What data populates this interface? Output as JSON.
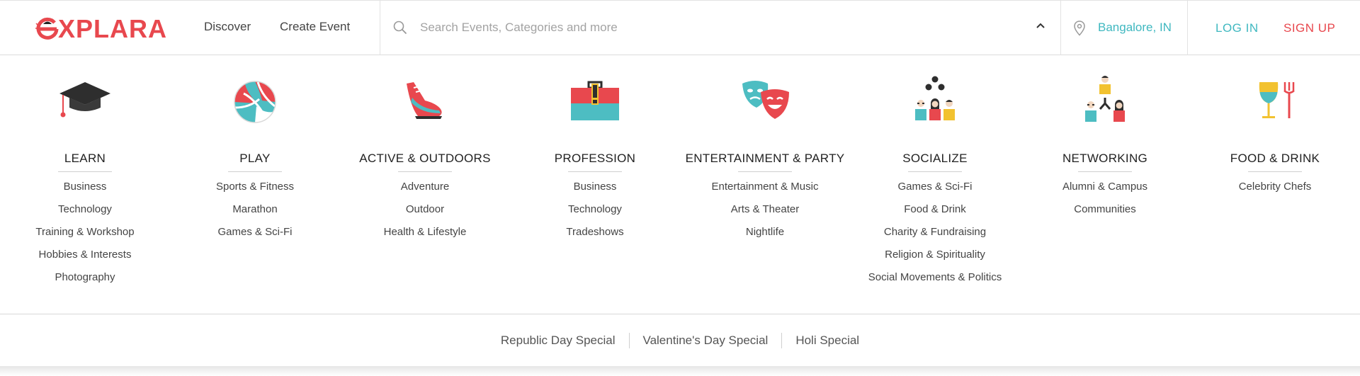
{
  "brand": {
    "logo_text": "XPLARA",
    "brand_color": "#e8484e",
    "accent_color": "#3fb8c0"
  },
  "nav": {
    "discover": "Discover",
    "create_event": "Create Event"
  },
  "search": {
    "placeholder": "Search Events, Categories and more",
    "value": ""
  },
  "location": {
    "text": "Bangalore, IN"
  },
  "auth": {
    "login": "LOG IN",
    "signup": "SIGN UP"
  },
  "categories": [
    {
      "title": "LEARN",
      "icon": "graduation-cap-icon",
      "items": [
        "Business",
        "Technology",
        "Training & Workshop",
        "Hobbies & Interests",
        "Photography"
      ]
    },
    {
      "title": "PLAY",
      "icon": "volleyball-icon",
      "items": [
        "Sports & Fitness",
        "Marathon",
        "Games & Sci-Fi"
      ]
    },
    {
      "title": "ACTIVE & OUTDOORS",
      "icon": "running-shoe-icon",
      "items": [
        "Adventure",
        "Outdoor",
        "Health & Lifestyle"
      ]
    },
    {
      "title": "PROFESSION",
      "icon": "briefcase-icon",
      "items": [
        "Business",
        "Technology",
        "Tradeshows"
      ]
    },
    {
      "title": "ENTERTAINMENT & PARTY",
      "icon": "theater-masks-icon",
      "items": [
        "Entertainment & Music",
        "Arts & Theater",
        "Nightlife"
      ]
    },
    {
      "title": "SOCIALIZE",
      "icon": "people-group-icon",
      "items": [
        "Games & Sci-Fi",
        "Food & Drink",
        "Charity & Fundraising",
        "Religion & Spirituality",
        "Social Movements & Politics"
      ]
    },
    {
      "title": "NETWORKING",
      "icon": "network-people-icon",
      "items": [
        "Alumni & Campus",
        "Communities"
      ]
    },
    {
      "title": "FOOD & DRINK",
      "icon": "wine-fork-icon",
      "items": [
        "Celebrity Chefs"
      ]
    }
  ],
  "specials": [
    "Republic Day Special",
    "Valentine's Day Special",
    "Holi Special"
  ]
}
